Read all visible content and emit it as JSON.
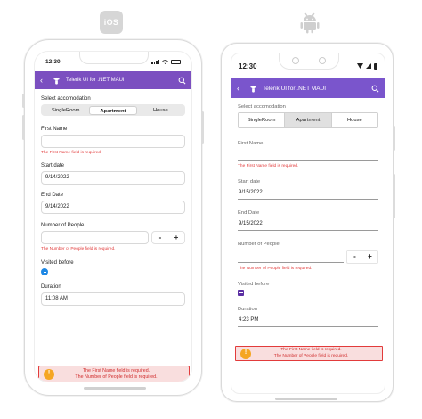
{
  "platforms": {
    "ios_logo": "iOS",
    "android_logo": "android-robot-icon"
  },
  "colors": {
    "accent": "#7b4fc0",
    "error": "#e23b3b",
    "error_bg": "#f9dede",
    "warning": "#f5a623"
  },
  "ios": {
    "status_time": "12:30",
    "appbar_title": "Telerik UI for .NET MAUI",
    "accomodation": {
      "label": "Select accomodation",
      "options": [
        "SingleRoom",
        "Apartment",
        "House"
      ],
      "selected": "Apartment"
    },
    "first_name": {
      "label": "First Name",
      "value": "",
      "error": "The First Name field is required."
    },
    "start_date": {
      "label": "Start date",
      "value": "9/14/2022"
    },
    "end_date": {
      "label": "End Date",
      "value": "9/14/2022"
    },
    "people": {
      "label": "Number of People",
      "value": "",
      "minus": "-",
      "plus": "+",
      "error": "The Number of People field is required."
    },
    "visited": {
      "label": "Visited before",
      "checked": true
    },
    "duration": {
      "label": "Duration",
      "value": "11:08 AM"
    },
    "summary": [
      "The First Name field is required.",
      "The Number of People field is required."
    ]
  },
  "android": {
    "status_time": "12:30",
    "appbar_title": "Telerik UI for .NET MAUI",
    "accomodation": {
      "label": "Select accomodation",
      "options": [
        "SingleRoom",
        "Apartment",
        "House"
      ],
      "selected": "Apartment"
    },
    "first_name": {
      "label": "First Name",
      "value": "",
      "error": "The First Name field is required."
    },
    "start_date": {
      "label": "Start date",
      "value": "9/15/2022"
    },
    "end_date": {
      "label": "End Date",
      "value": "9/15/2022"
    },
    "people": {
      "label": "Number of People",
      "value": "",
      "minus": "-",
      "plus": "+",
      "error": "The Number of People field is required."
    },
    "visited": {
      "label": "Visited before",
      "checked": true
    },
    "duration": {
      "label": "Duration",
      "value": "4:23 PM"
    },
    "summary": [
      "The First Name field is required.",
      "The Number of People field is required."
    ]
  }
}
